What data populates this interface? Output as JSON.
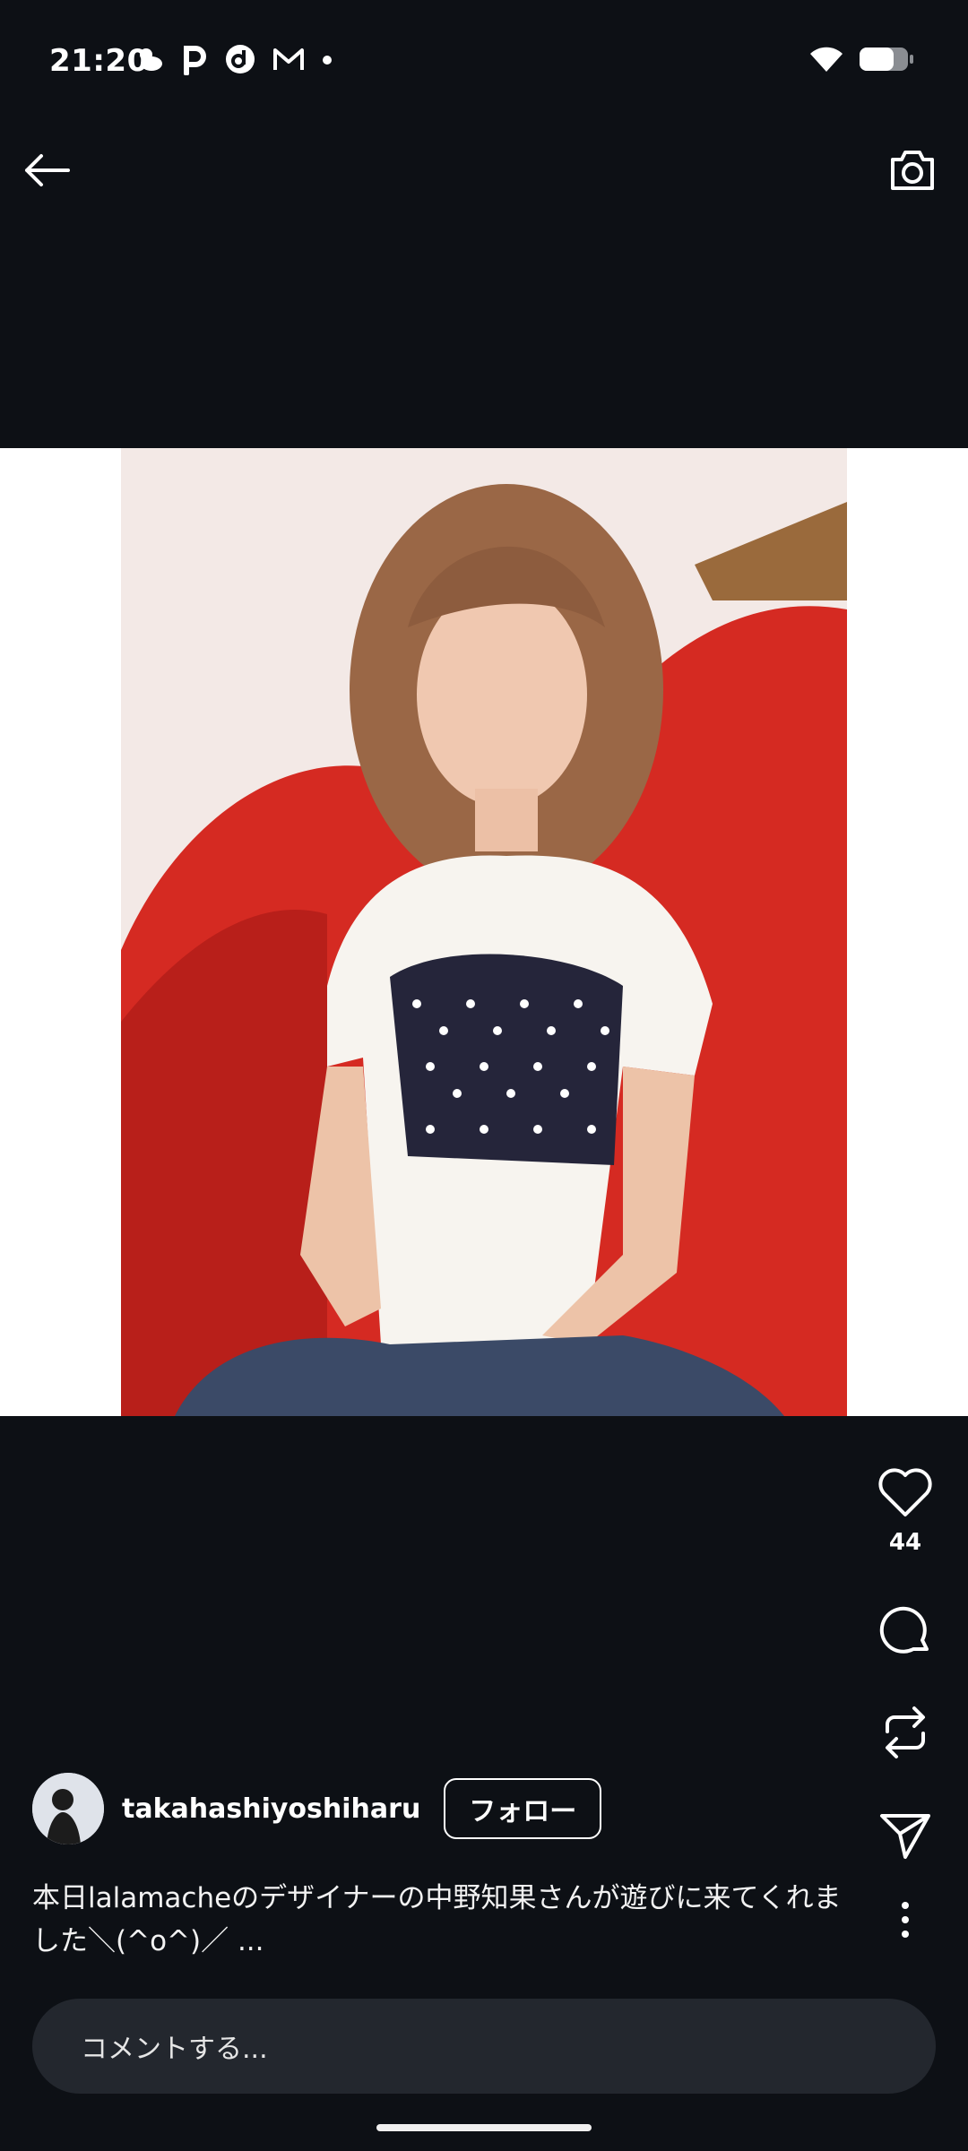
{
  "status_bar": {
    "time": "21:20",
    "notification_icons": [
      "weather-icon",
      "p-app-icon",
      "d-app-icon",
      "mail-icon",
      "dot-icon"
    ],
    "wifi_icon": "wifi-icon",
    "battery_icon": "battery-icon"
  },
  "app_bar": {
    "back_icon": "arrow-left-icon",
    "camera_icon": "camera-icon"
  },
  "post": {
    "author": "takahashiyoshiharu",
    "follow_label": "フォロー",
    "caption": "本日lalamacheのデザイナーの中野知果さんが遊びに来てくれました＼(^o^)／ ...",
    "like_count": "44"
  },
  "actions": {
    "like_icon": "heart-icon",
    "comment_icon": "comment-icon",
    "repost_icon": "repost-icon",
    "share_icon": "send-icon",
    "more_icon": "more-vertical-icon"
  },
  "comment": {
    "placeholder": "コメントする..."
  },
  "colors": {
    "background": "#0d1015",
    "comment_bar": "#23272e",
    "text": "#ffffff"
  }
}
